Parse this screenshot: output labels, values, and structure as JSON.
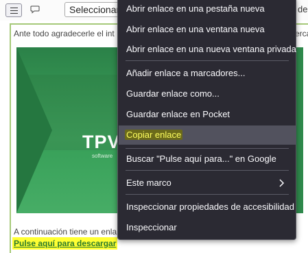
{
  "toolbar": {
    "select_label": "Seleccionar",
    "right_text": "de"
  },
  "page": {
    "intro_text": "Ante todo agradecerle el int",
    "intro_right": "erca",
    "brand_name": "TPVS",
    "brand_tagline": "software",
    "continuation_text": "A continuación tiene un enla",
    "download_link": "Pulse aquí para descargar"
  },
  "context_menu": {
    "items": [
      {
        "label": "Abrir enlace en una pestaña nueva"
      },
      {
        "label": "Abrir enlace en una ventana nueva"
      },
      {
        "label": "Abrir enlace en una nueva ventana privada"
      },
      {
        "label": "Añadir enlace a marcadores..."
      },
      {
        "label": "Guardar enlace como..."
      },
      {
        "label": "Guardar enlace en Pocket"
      },
      {
        "label": "Copiar enlace"
      },
      {
        "label": "Buscar \"Pulse aquí para...\" en Google"
      },
      {
        "label": "Este marco"
      },
      {
        "label": "Inspeccionar propiedades de accesibilidad"
      },
      {
        "label": "Inspeccionar"
      }
    ],
    "hovered_item": "Copiar enlace",
    "submenu_icon": "chevron-right-icon"
  },
  "colors": {
    "menu_bg": "#2b2a33",
    "menu_hover": "#52525e",
    "menu_text": "#fbfbfe",
    "link_highlight": "#ffff33",
    "link_text": "#2b7a2b",
    "banner_green": "#2f8a4c"
  }
}
